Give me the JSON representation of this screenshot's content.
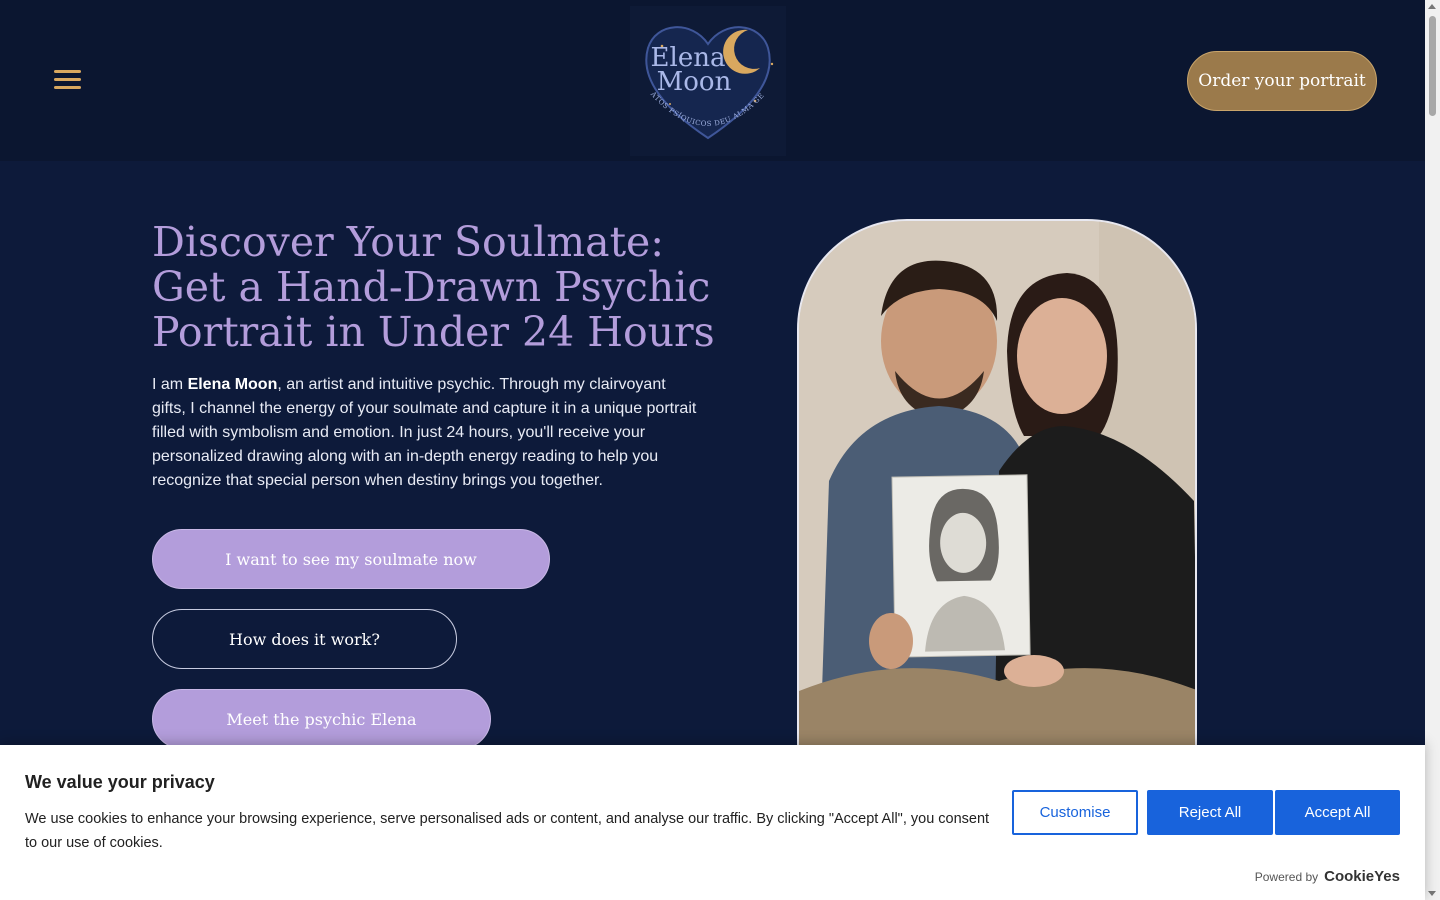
{
  "header": {
    "logo": {
      "name_line1": "Elena",
      "name_line2": "Moon",
      "tagline": "RETRATOS PSÍQUICOS DEU ALMA GEMELA"
    },
    "menu_icon": "hamburger-menu-icon",
    "order_button": "Order your portrait"
  },
  "hero": {
    "title_lines": [
      "Discover Your Soulmate:",
      "Get a Hand-Drawn Psychic",
      "Portrait in Under 24 Hours"
    ],
    "intro_prefix": "I am ",
    "intro_name": "Elena Moon",
    "intro_suffix": ", an artist and intuitive psychic. Through my clairvoyant gifts, I channel the energy of your soulmate and capture it in a unique portrait filled with symbolism and emotion. In just 24 hours, you'll receive your personalized drawing along with an in-depth energy reading to help you recognize that special person when destiny brings you together.",
    "buttons": {
      "primary": "I want to see my soulmate now",
      "how": "How does it work?",
      "meet": "Meet the psychic Elena"
    }
  },
  "cookie_banner": {
    "title": "We value your privacy",
    "text": "We use cookies to enhance your browsing experience, serve personalised ads or content, and analyse our traffic. By clicking \"Accept All\", you consent to our use of cookies.",
    "customise": "Customise",
    "reject": "Reject All",
    "accept": "Accept All",
    "powered_by": "Powered by",
    "brand": "CookieYes"
  },
  "colors": {
    "header_bg": "#0b1630",
    "page_bg": "#0d1a3a",
    "accent_lavender": "#b39ddb",
    "accent_gold": "#9b7a4b",
    "cookie_blue": "#1863dc"
  }
}
